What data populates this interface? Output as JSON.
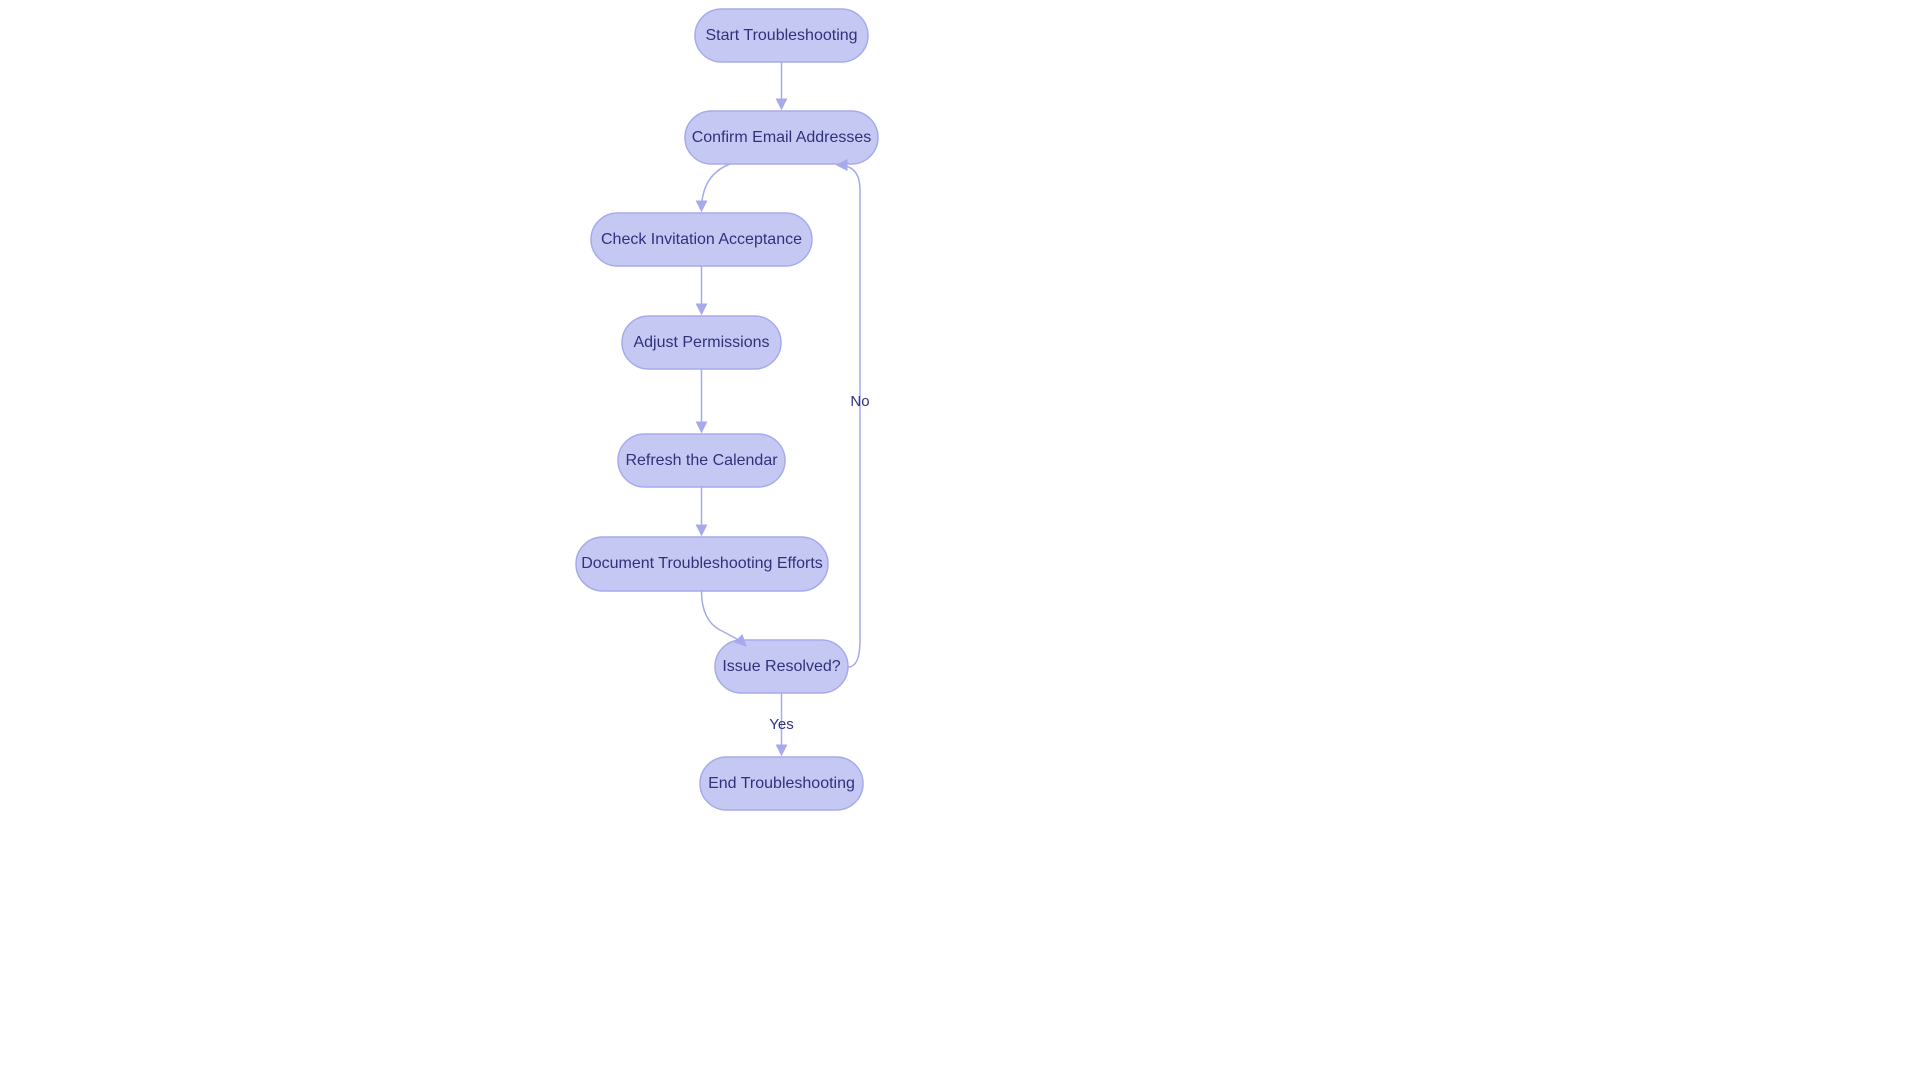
{
  "nodes": {
    "start": "Start Troubleshooting",
    "confirm": "Confirm Email Addresses",
    "check": "Check Invitation Acceptance",
    "adjust": "Adjust Permissions",
    "refresh": "Refresh the Calendar",
    "document": "Document Troubleshooting Efforts",
    "issue": "Issue Resolved?",
    "end": "End Troubleshooting"
  },
  "edgeLabels": {
    "yes": "Yes",
    "no": "No"
  }
}
